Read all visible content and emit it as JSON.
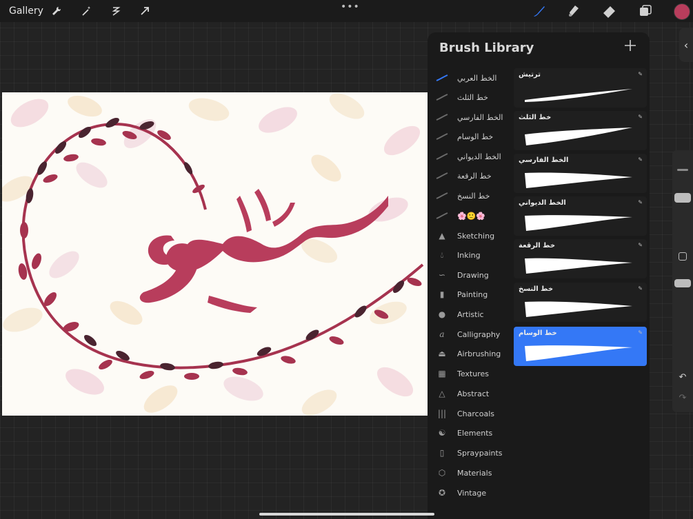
{
  "topbar": {
    "gallery_label": "Gallery",
    "dots": "•••",
    "tools": [
      {
        "icon": "wrench-icon"
      },
      {
        "icon": "magic-wand-icon"
      },
      {
        "icon": "selection-icon"
      },
      {
        "icon": "transform-arrow-icon"
      }
    ],
    "right_tools": [
      {
        "icon": "brush-icon",
        "active": true
      },
      {
        "icon": "smudge-icon"
      },
      {
        "icon": "eraser-icon"
      },
      {
        "icon": "layers-icon"
      }
    ],
    "current_color": "#b83d5c"
  },
  "library": {
    "title": "Brush Library",
    "categories": [
      {
        "label": "الخط العربي",
        "active": true
      },
      {
        "label": "خط الثلث"
      },
      {
        "label": "الخط الفارسي"
      },
      {
        "label": "خط الوسام"
      },
      {
        "label": "الخط الديواني"
      },
      {
        "label": "خط الرقعة"
      },
      {
        "label": "خط النسخ"
      },
      {
        "label": "🌸🙂🌸"
      },
      {
        "label": "Sketching"
      },
      {
        "label": "Inking"
      },
      {
        "label": "Drawing"
      },
      {
        "label": "Painting"
      },
      {
        "label": "Artistic"
      },
      {
        "label": "Calligraphy"
      },
      {
        "label": "Airbrushing"
      },
      {
        "label": "Textures"
      },
      {
        "label": "Abstract"
      },
      {
        "label": "Charcoals"
      },
      {
        "label": "Elements"
      },
      {
        "label": "Spraypaints"
      },
      {
        "label": "Materials"
      },
      {
        "label": "Vintage"
      }
    ],
    "brushes": [
      {
        "label": "ترتيش"
      },
      {
        "label": "خط الثلث"
      },
      {
        "label": "الخط الفارسي"
      },
      {
        "label": "الخط الديواني"
      },
      {
        "label": "خط الرقعة"
      },
      {
        "label": "خط النسخ"
      },
      {
        "label": "خط الوسام",
        "selected": true
      }
    ]
  },
  "colors": {
    "accent": "#3478f6",
    "calligraphy": "#b83d5c",
    "leaf_dark": "#4a2430",
    "leaf_mid": "#a6334f"
  }
}
